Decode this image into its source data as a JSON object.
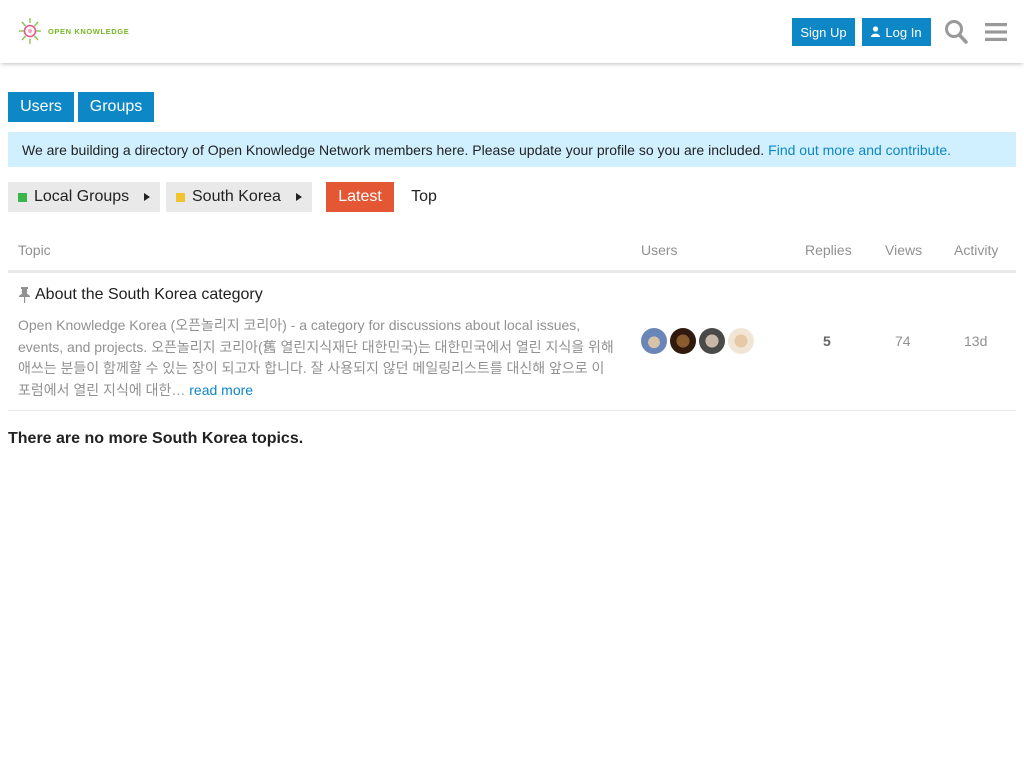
{
  "header": {
    "logo_text": "OPEN KNOWLEDGE",
    "signup_label": "Sign Up",
    "login_label": "Log In"
  },
  "nav": {
    "users_label": "Users",
    "groups_label": "Groups"
  },
  "banner": {
    "text": "We are building a directory of Open Knowledge Network members here. Please update your profile so you are included.",
    "link_text": "Find out more and contribute."
  },
  "category_nav": {
    "parent": {
      "label": "Local Groups",
      "color": "#3ab54a"
    },
    "child": {
      "label": "South Korea",
      "color": "#f1c232"
    },
    "latest_label": "Latest",
    "top_label": "Top"
  },
  "table": {
    "headers": {
      "topic": "Topic",
      "users": "Users",
      "replies": "Replies",
      "views": "Views",
      "activity": "Activity"
    },
    "rows": [
      {
        "title": "About the South Korea category",
        "excerpt": "Open Knowledge Korea (오픈놀리지 코리아) - a category for discussions about local issues, events, and projects. 오픈놀리지 코리아(舊 열린지식재단 대한민국)는 대한민국에서 열린 지식을 위해 애쓰는 분들이 함께할 수 있는 장이 되고자 합니다. 잘 사용되지 않던 메일링리스트를 대신해 앞으로 이 포럼에서 열린 지식에 대한…",
        "read_more": "read more",
        "replies": "5",
        "views": "74",
        "activity": "13d"
      }
    ]
  },
  "footer_message": "There are no more South Korea topics.",
  "colors": {
    "primary": "#0e87c7",
    "latest": "#e45735",
    "banner_bg": "#d1f0ff"
  }
}
